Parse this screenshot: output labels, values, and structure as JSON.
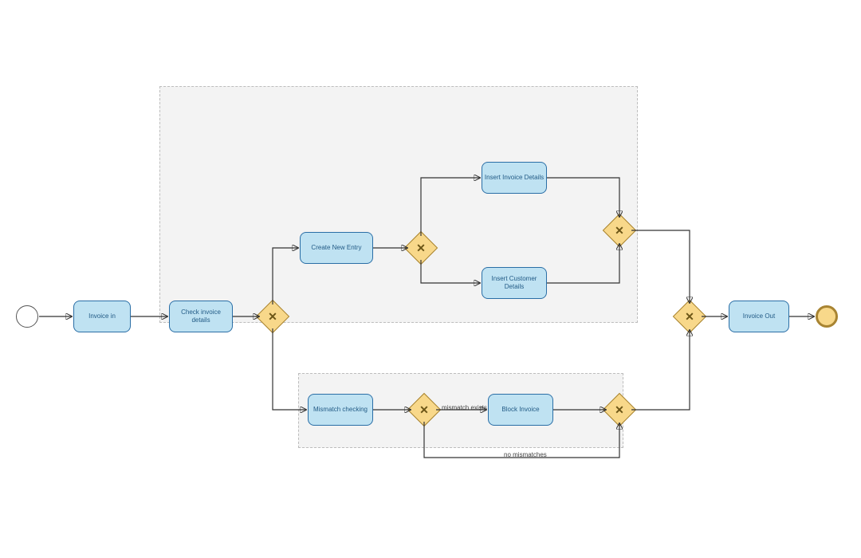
{
  "diagram": {
    "tasks": {
      "invoice_in": "Invoice in",
      "check_invoice_details": "Check invoice details",
      "create_new_entry": "Create New Entry",
      "insert_invoice_details": "Insert Invoice Details",
      "insert_customer_details": "Insert Customer Details",
      "mismatch_checking": "Mismatch checking",
      "block_invoice": "Block Invoice",
      "invoice_out": "Invoice Out"
    },
    "labels": {
      "mismatch_exists": "mismatch exists",
      "no_mismatches": "no mismatches"
    }
  }
}
